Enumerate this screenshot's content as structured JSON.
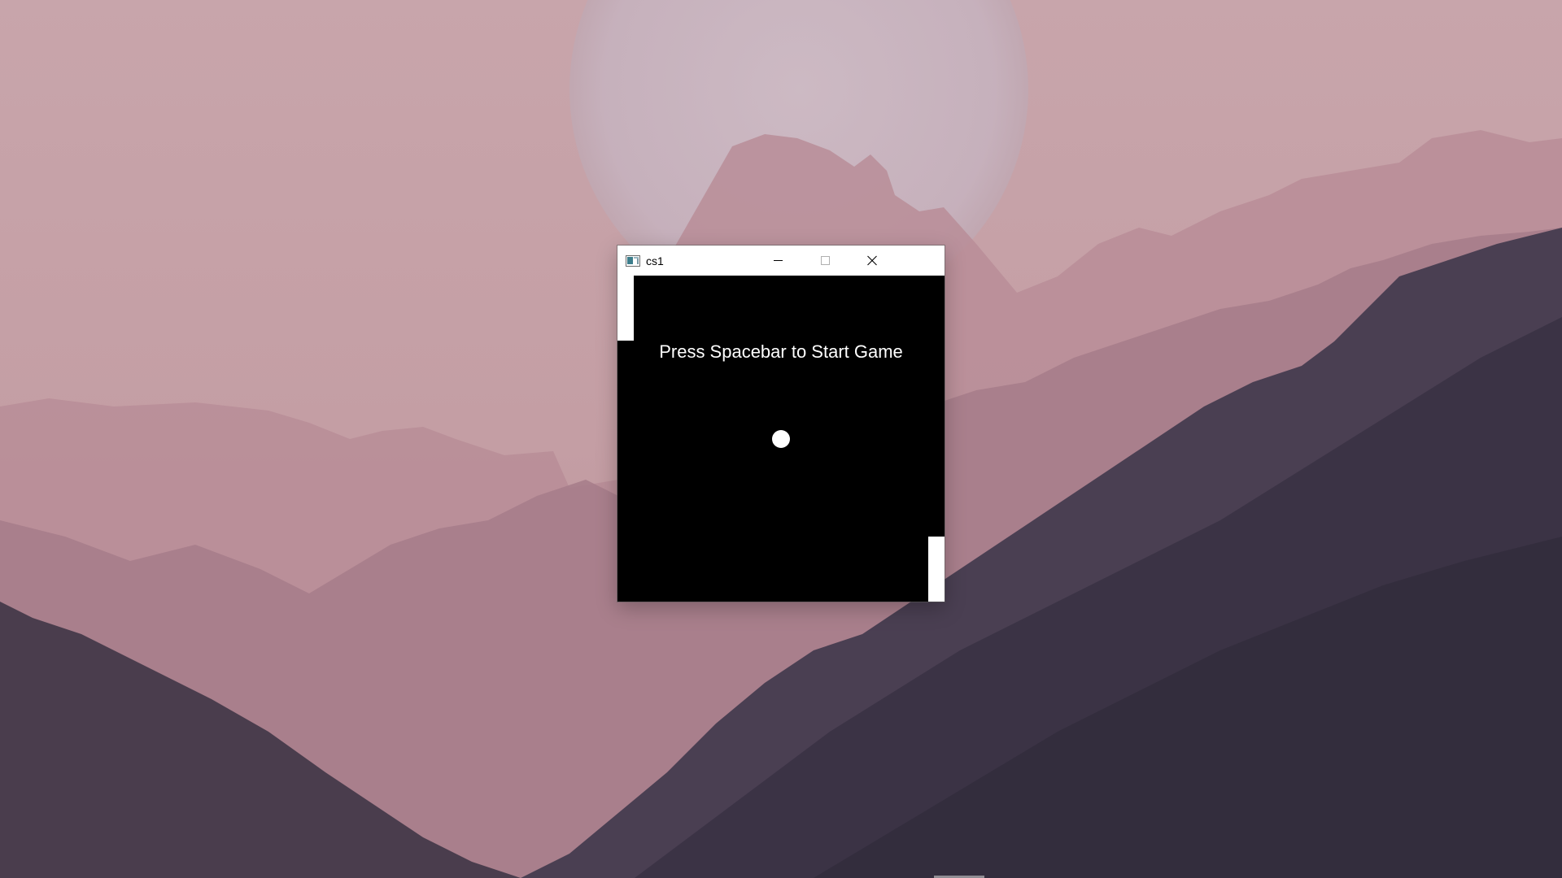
{
  "window": {
    "title": "cs1",
    "icon": "app-window-icon",
    "controls": {
      "minimize_icon": "minimize-icon",
      "maximize_icon": "maximize-icon",
      "close_icon": "close-icon"
    }
  },
  "game": {
    "prompt": "Press Spacebar to Start Game",
    "background_color": "#000000",
    "foreground_color": "#ffffff"
  },
  "desktop": {
    "wallpaper": "pink misty mountains with pale moon",
    "sky_color": "#c9a9ae",
    "mountain_color": "#3d3443"
  }
}
